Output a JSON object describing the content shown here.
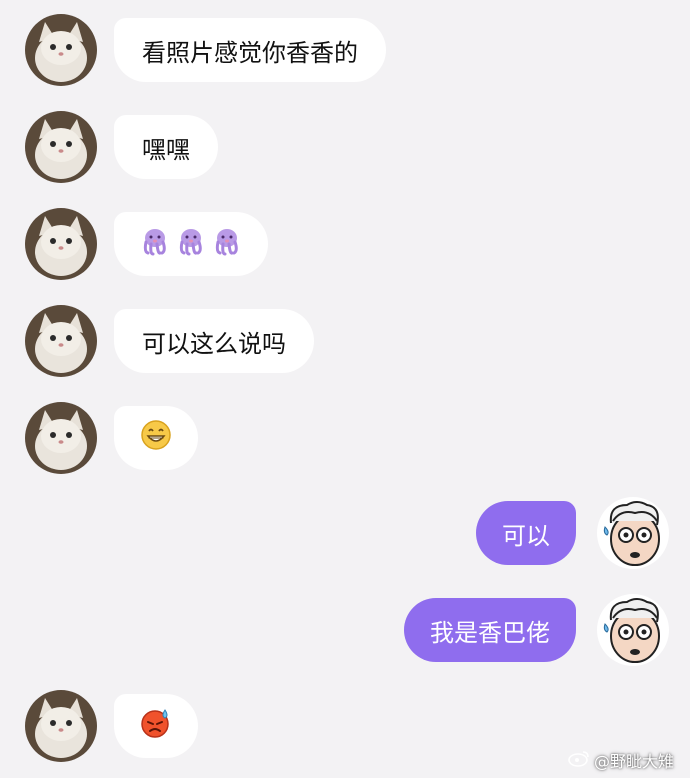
{
  "messages": [
    {
      "side": "in",
      "text": "看照片感觉你香香的"
    },
    {
      "side": "in",
      "text": "嘿嘿"
    },
    {
      "side": "in",
      "emoji": [
        "octopus-shy-emoji",
        "octopus-shy-emoji",
        "octopus-shy-emoji"
      ]
    },
    {
      "side": "in",
      "text": "可以这么说吗"
    },
    {
      "side": "in",
      "emoji": [
        "grin-face-emoji"
      ]
    },
    {
      "side": "out",
      "text": "可以"
    },
    {
      "side": "out",
      "text": "我是香巴佬"
    },
    {
      "side": "in",
      "emoji": [
        "red-sweat-face-emoji"
      ]
    }
  ],
  "colors": {
    "background": "#f3f2f4",
    "incoming_bubble": "#ffffff",
    "outgoing_bubble": "#8f6dee"
  },
  "watermark": {
    "text": "@野眦大雉",
    "icon": "weibo-icon"
  }
}
